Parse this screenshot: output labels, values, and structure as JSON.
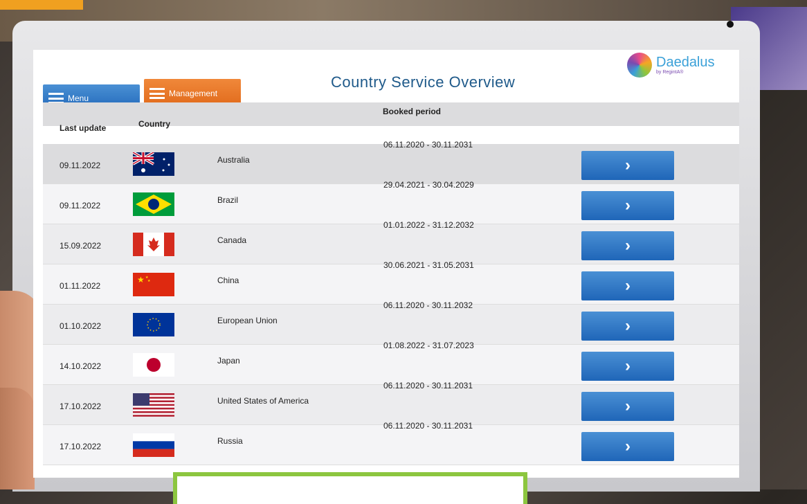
{
  "app": {
    "title": "Country Service Overview",
    "logo_name": "Daedalus",
    "logo_sub": "by RegintA®"
  },
  "nav": {
    "menu_label": "Menu",
    "management_label": "Management"
  },
  "table": {
    "headers": {
      "last_update": "Last update",
      "country": "Country",
      "booked_period": "Booked period"
    },
    "rows": [
      {
        "last_update": "09.11.2022",
        "country": "Australia",
        "period": "06.11.2020 - 30.11.2031",
        "flag": "australia-flag"
      },
      {
        "last_update": "09.11.2022",
        "country": "Brazil",
        "period": "29.04.2021 - 30.04.2029",
        "flag": "brazil-flag"
      },
      {
        "last_update": "15.09.2022",
        "country": "Canada",
        "period": "01.01.2022 - 31.12.2032",
        "flag": "canada-flag"
      },
      {
        "last_update": "01.11.2022",
        "country": "China",
        "period": "30.06.2021 - 31.05.2031",
        "flag": "china-flag"
      },
      {
        "last_update": "01.10.2022",
        "country": "European Union",
        "period": "06.11.2020 - 30.11.2032",
        "flag": "eu-flag"
      },
      {
        "last_update": "14.10.2022",
        "country": "Japan",
        "period": "01.08.2022 - 31.07.2023",
        "flag": "japan-flag"
      },
      {
        "last_update": "17.10.2022",
        "country": "United States of America",
        "period": "06.11.2020 - 30.11.2031",
        "flag": "usa-flag"
      },
      {
        "last_update": "17.10.2022",
        "country": "Russia",
        "period": "06.11.2020 - 30.11.2031",
        "flag": "russia-flag"
      }
    ],
    "go_icon": "chevron-right-icon"
  },
  "colors": {
    "accent_blue": "#1f66b8",
    "accent_orange": "#e0691a",
    "title_blue": "#1f5a8a"
  }
}
